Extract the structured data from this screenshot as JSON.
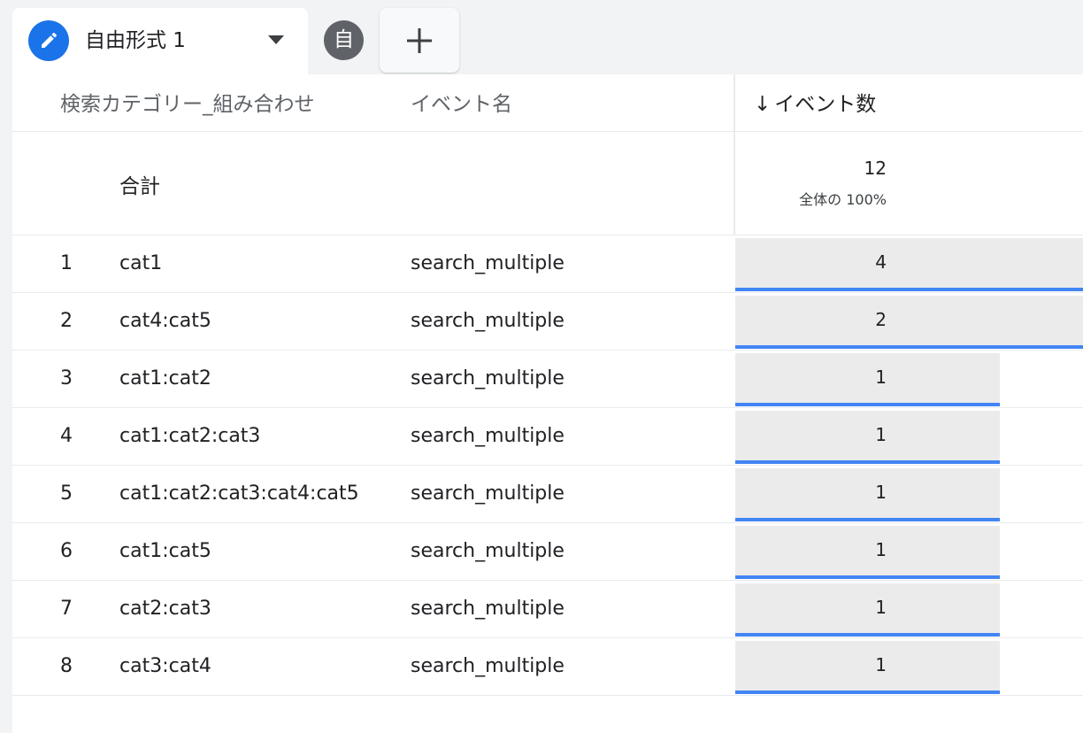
{
  "tabs": {
    "active_label": "自由形式 1",
    "mini_label": "自",
    "add_icon": "plus-icon",
    "edit_icon": "pencil-icon"
  },
  "table": {
    "headers": {
      "dimension": "検索カテゴリー_組み合わせ",
      "event_name": "イベント名",
      "metric": "イベント数",
      "sort_arrow": "↓"
    },
    "total": {
      "label": "合計",
      "value": "12",
      "percent_text": "全体の 100%"
    },
    "rows": [
      {
        "index": "1",
        "category": "cat1",
        "event": "search_multiple",
        "count": "4",
        "bar_fraction": 1.0
      },
      {
        "index": "2",
        "category": "cat4:cat5",
        "event": "search_multiple",
        "count": "2",
        "bar_fraction": 1.0
      },
      {
        "index": "3",
        "category": "cat1:cat2",
        "event": "search_multiple",
        "count": "1",
        "bar_fraction": 0.76
      },
      {
        "index": "4",
        "category": "cat1:cat2:cat3",
        "event": "search_multiple",
        "count": "1",
        "bar_fraction": 0.76
      },
      {
        "index": "5",
        "category": "cat1:cat2:cat3:cat4:cat5",
        "event": "search_multiple",
        "count": "1",
        "bar_fraction": 0.76
      },
      {
        "index": "6",
        "category": "cat1:cat5",
        "event": "search_multiple",
        "count": "1",
        "bar_fraction": 0.76
      },
      {
        "index": "7",
        "category": "cat2:cat3",
        "event": "search_multiple",
        "count": "1",
        "bar_fraction": 0.76
      },
      {
        "index": "8",
        "category": "cat3:cat4",
        "event": "search_multiple",
        "count": "1",
        "bar_fraction": 0.76
      }
    ]
  },
  "colors": {
    "accent": "#1a73e8",
    "bar_line": "#4285f4",
    "bar_fill": "#ebebeb"
  }
}
